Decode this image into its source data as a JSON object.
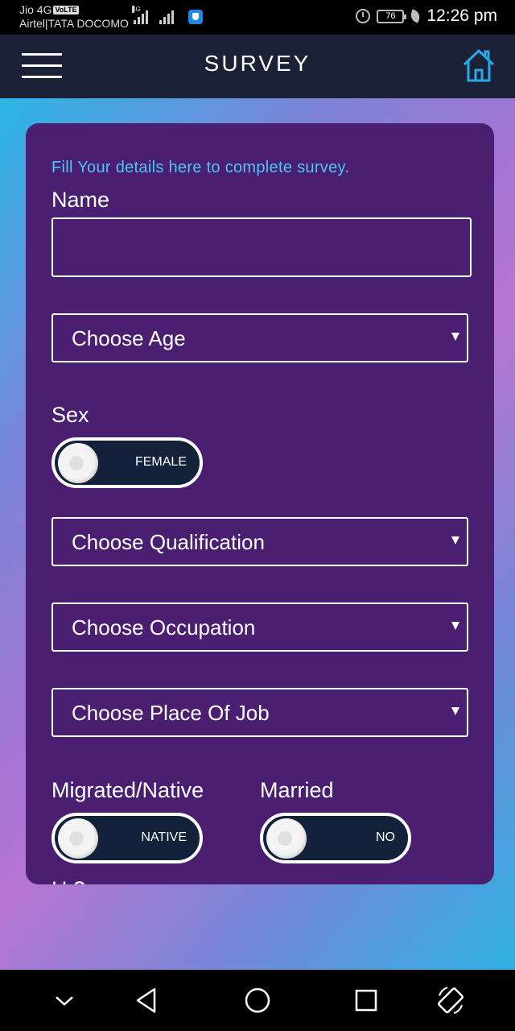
{
  "status_bar": {
    "carrier1": "Jio 4G",
    "volte": "VoLTE",
    "carrier2": "Airtel|TATA DOCOMO",
    "network_tag": "4G",
    "battery": "76",
    "time": "12:26 pm"
  },
  "header": {
    "title": "SURVEY",
    "menu_icon": "hamburger-menu-icon",
    "home_icon": "home-icon",
    "accent": "#29a9e8"
  },
  "form": {
    "intro": "Fill Your details here to complete survey.",
    "name_label": "Name",
    "name_value": "",
    "age_select": "Choose Age",
    "sex_label": "Sex",
    "sex_toggle": "FEMALE",
    "qualification_select": "Choose Qualification",
    "occupation_select": "Choose Occupation",
    "place_select": "Choose Place Of Job",
    "migrated_label": "Migrated/Native",
    "migrated_toggle": "NATIVE",
    "married_label": "Married",
    "married_toggle": "NO",
    "next_label_partial": "H         ?"
  },
  "colors": {
    "card": "#4a1f72",
    "intro_text": "#4fc3f7",
    "header_bg": "#1b2238",
    "toggle_bg": "#13213a"
  },
  "nav": {
    "icons": [
      "chevron-down-icon",
      "back-triangle-icon",
      "home-circle-icon",
      "recents-square-icon",
      "rotate-icon"
    ]
  }
}
